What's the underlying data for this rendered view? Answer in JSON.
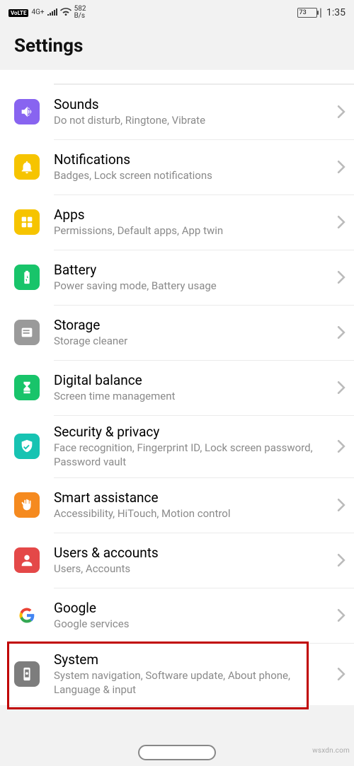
{
  "status": {
    "volte": "VoLTE",
    "net_gen": "4G+",
    "rate_top": "582",
    "rate_unit": "B/s",
    "battery_pct": "73",
    "time": "1:35"
  },
  "header": {
    "title": "Settings"
  },
  "rows": [
    {
      "key": "sounds",
      "title": "Sounds",
      "sub": "Do not disturb, Ringtone, Vibrate",
      "bg": "#8864f0",
      "icon": "sound"
    },
    {
      "key": "notifications",
      "title": "Notifications",
      "sub": "Badges, Lock screen notifications",
      "bg": "#f6c400",
      "icon": "bell"
    },
    {
      "key": "apps",
      "title": "Apps",
      "sub": "Permissions, Default apps, App twin",
      "bg": "#f6c400",
      "icon": "grid"
    },
    {
      "key": "battery",
      "title": "Battery",
      "sub": "Power saving mode, Battery usage",
      "bg": "#18c46a",
      "icon": "battery"
    },
    {
      "key": "storage",
      "title": "Storage",
      "sub": "Storage cleaner",
      "bg": "#9a9a9a",
      "icon": "storage"
    },
    {
      "key": "digital",
      "title": "Digital balance",
      "sub": "Screen time management",
      "bg": "#18c46a",
      "icon": "hourglass"
    },
    {
      "key": "security",
      "title": "Security & privacy",
      "sub": "Face recognition, Fingerprint ID, Lock screen password, Password vault",
      "bg": "#17c3b2",
      "icon": "shield"
    },
    {
      "key": "smart",
      "title": "Smart assistance",
      "sub": "Accessibility, HiTouch, Motion control",
      "bg": "#f58a1f",
      "icon": "hand"
    },
    {
      "key": "users",
      "title": "Users & accounts",
      "sub": "Users, Accounts",
      "bg": "#e44848",
      "icon": "user"
    },
    {
      "key": "google",
      "title": "Google",
      "sub": "Google services",
      "bg": "transparent",
      "icon": "google"
    },
    {
      "key": "system",
      "title": "System",
      "sub": "System navigation, Software update, About phone, Language & input",
      "bg": "#7d7d7d",
      "icon": "phone",
      "highlight": true
    }
  ],
  "watermark": "wsxdn.com"
}
